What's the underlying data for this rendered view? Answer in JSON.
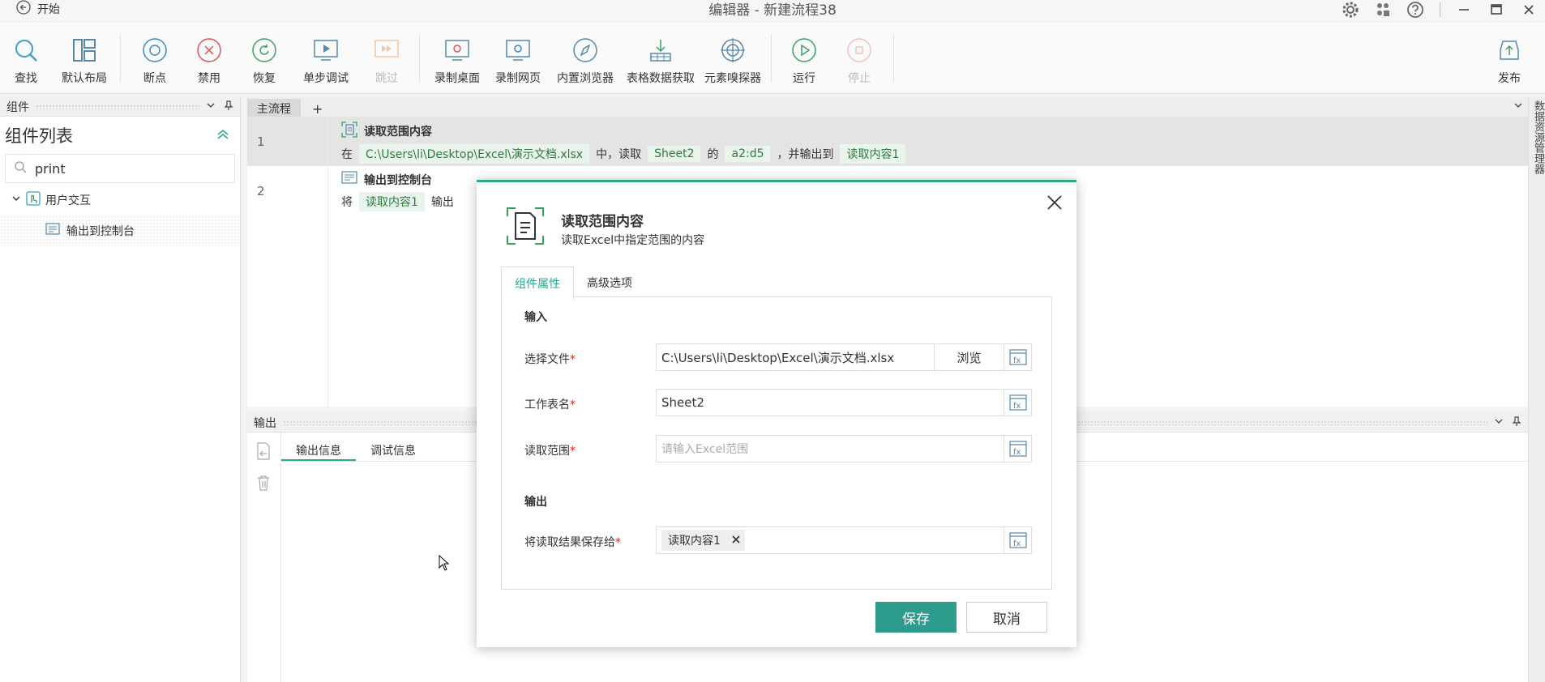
{
  "window": {
    "start_label": "开始",
    "title": "编辑器 - 新建流程38"
  },
  "toolbar": {
    "items": [
      {
        "label": "查找",
        "icon": "search-icon"
      },
      {
        "label": "默认布局",
        "icon": "layout-icon"
      },
      {
        "label": "断点",
        "icon": "breakpoint-icon"
      },
      {
        "label": "禁用",
        "icon": "disable-icon"
      },
      {
        "label": "恢复",
        "icon": "restore-icon"
      },
      {
        "label": "单步调试",
        "icon": "step-debug-icon"
      },
      {
        "label": "跳过",
        "icon": "skip-icon"
      },
      {
        "label": "录制桌面",
        "icon": "record-desktop-icon"
      },
      {
        "label": "录制网页",
        "icon": "record-web-icon"
      },
      {
        "label": "内置浏览器",
        "icon": "browser-icon"
      },
      {
        "label": "表格数据获取",
        "icon": "table-data-icon"
      },
      {
        "label": "元素嗅探器",
        "icon": "element-sniffer-icon"
      },
      {
        "label": "运行",
        "icon": "run-icon"
      },
      {
        "label": "停止",
        "icon": "stop-icon"
      },
      {
        "label": "发布",
        "icon": "publish-icon"
      }
    ]
  },
  "left_panel": {
    "header": "组件",
    "title": "组件列表",
    "search_value": "print",
    "group_label": "用户交互",
    "item_label": "输出到控制台"
  },
  "editor": {
    "tab_label": "主流程",
    "add_tab": "+",
    "rows": [
      {
        "number": "1",
        "title": "读取范围内容",
        "desc_prefix": "在",
        "file": "C:\\Users\\li\\Desktop\\Excel\\演示文档.xlsx",
        "mid1": "中，读取",
        "sheet": "Sheet2",
        "mid2": "的",
        "range": "a2:d5",
        "mid3": "，并输出到",
        "output": "读取内容1"
      },
      {
        "number": "2",
        "title": "输出到控制台",
        "desc_prefix": "将",
        "var": "读取内容1",
        "suffix": "输出"
      }
    ]
  },
  "right_strip": {
    "label": "数据资源管理器"
  },
  "output_panel": {
    "header": "输出",
    "tabs": [
      "输出信息",
      "调试信息"
    ]
  },
  "dialog": {
    "title": "读取范围内容",
    "subtitle": "读取Excel中指定范围的内容",
    "tabs": [
      "组件属性",
      "高级选项"
    ],
    "input_section": "输入",
    "output_section": "输出",
    "file_label": "选择文件",
    "file_value": "C:\\Users\\li\\Desktop\\Excel\\演示文档.xlsx",
    "browse_label": "浏览",
    "sheet_label": "工作表名",
    "sheet_value": "Sheet2",
    "range_label": "读取范围",
    "range_placeholder": "请输入Excel范围",
    "save_to_label": "将读取结果保存给",
    "save_to_tag": "读取内容1",
    "save_button": "保存",
    "cancel_button": "取消",
    "required_mark": "*"
  },
  "colors": {
    "accent": "#2aa88c",
    "save_button": "#2d9c8c",
    "chip_bg": "#e9f5ec",
    "chip_text": "#2d7a3c"
  }
}
